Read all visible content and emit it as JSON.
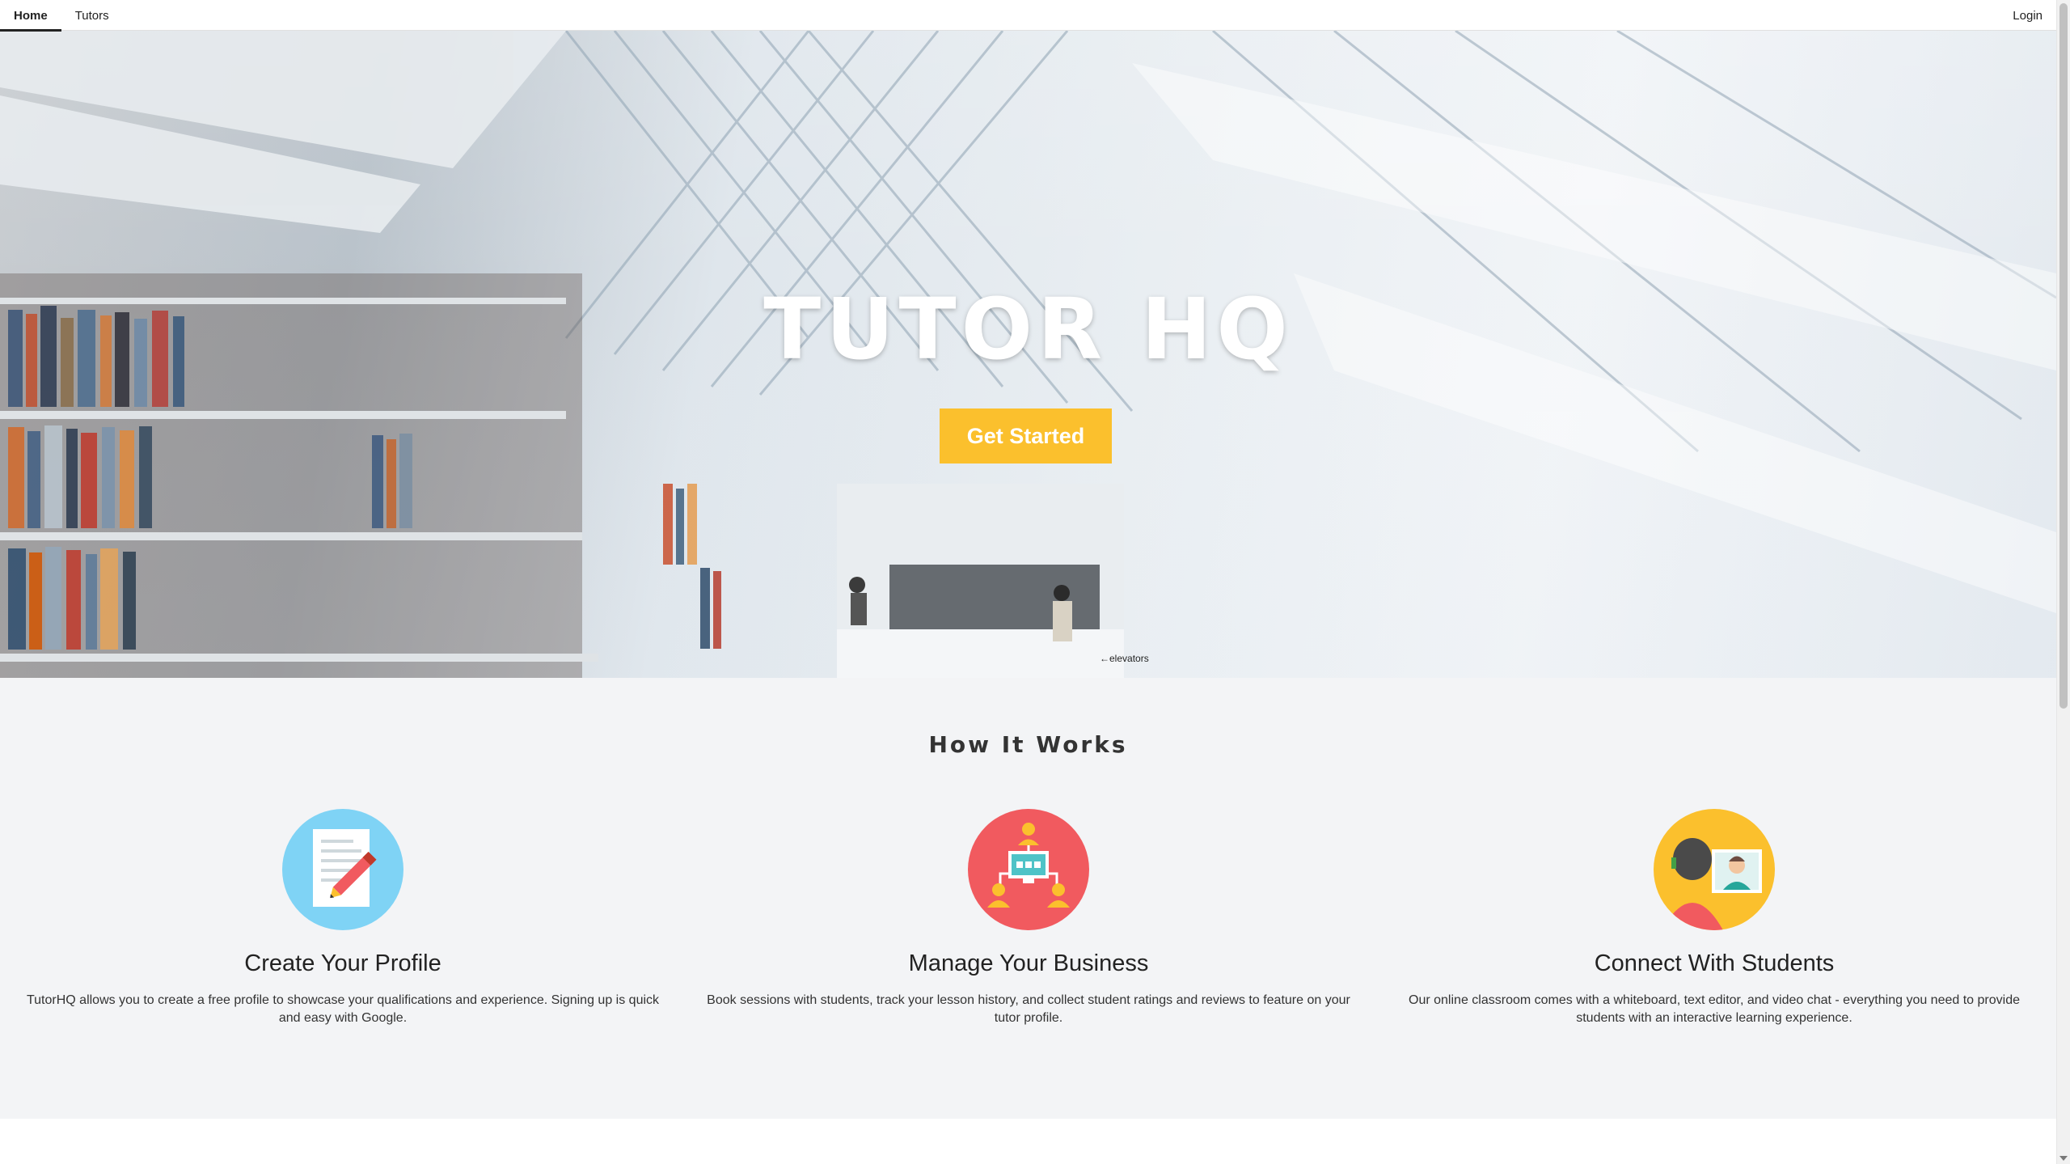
{
  "nav": {
    "items": [
      {
        "label": "Home",
        "active": true
      },
      {
        "label": "Tutors",
        "active": false
      }
    ],
    "login_label": "Login"
  },
  "hero": {
    "title": "TUTOR HQ",
    "cta_label": "Get Started",
    "cta_color": "#fbc02d",
    "background": "library-bookshelves-photo"
  },
  "how_it_works": {
    "title": "How It Works",
    "features": [
      {
        "icon": "profile-document-pencil-icon",
        "icon_color": "#7fd3f5",
        "title": "Create Your Profile",
        "description": "TutorHQ allows you to create a free profile to showcase your qualifications and experience. Signing up is quick and easy with Google."
      },
      {
        "icon": "business-network-computer-icon",
        "icon_color": "#f15a5f",
        "title": "Manage Your Business",
        "description": "Book sessions with students, track your lesson history, and collect student ratings and reviews to feature on your tutor profile."
      },
      {
        "icon": "video-chat-students-icon",
        "icon_color": "#fbc02d",
        "title": "Connect With Students",
        "description": "Our online classroom comes with a whiteboard, text editor, and video chat - everything you need to provide students with an interactive learning experience."
      }
    ]
  }
}
